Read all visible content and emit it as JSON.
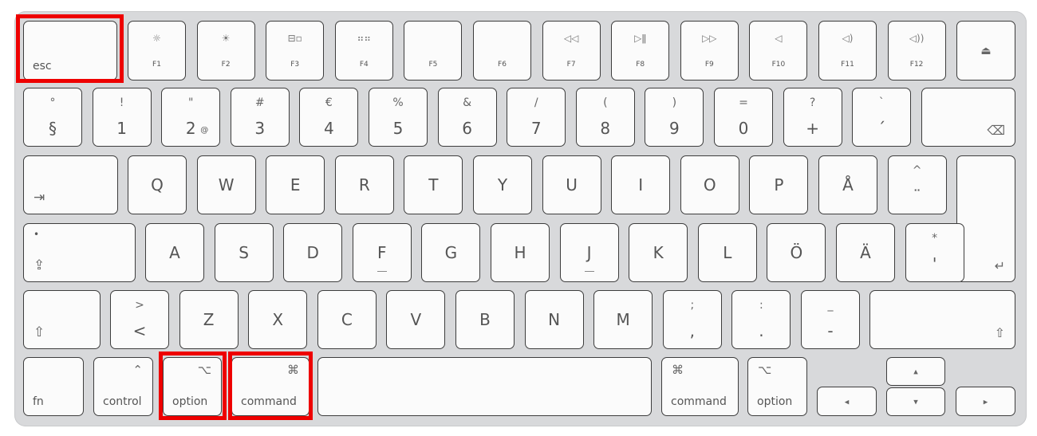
{
  "highlight_color": "#ee0000",
  "highlighted_keys": [
    "esc",
    "option",
    "command"
  ],
  "rows": [
    {
      "keys": [
        {
          "label": "esc"
        },
        {
          "label": "F1",
          "icon": "brightness-down-icon",
          "glyph": "☼"
        },
        {
          "label": "F2",
          "icon": "brightness-up-icon",
          "glyph": "☀"
        },
        {
          "label": "F3",
          "icon": "mission-control-icon",
          "glyph": "⊟▫"
        },
        {
          "label": "F4",
          "icon": "launchpad-icon",
          "glyph": "⠶⠶"
        },
        {
          "label": "F5"
        },
        {
          "label": "F6"
        },
        {
          "label": "F7",
          "icon": "rewind-icon",
          "glyph": "◁◁"
        },
        {
          "label": "F8",
          "icon": "play-pause-icon",
          "glyph": "▷ǁ"
        },
        {
          "label": "F9",
          "icon": "fast-forward-icon",
          "glyph": "▷▷"
        },
        {
          "label": "F10",
          "icon": "mute-icon",
          "glyph": "◁"
        },
        {
          "label": "F11",
          "icon": "volume-down-icon",
          "glyph": "◁)"
        },
        {
          "label": "F12",
          "icon": "volume-up-icon",
          "glyph": "◁))"
        },
        {
          "icon": "eject-icon",
          "glyph": "⏏"
        }
      ]
    },
    {
      "keys": [
        {
          "top": "°",
          "bottom": "§"
        },
        {
          "top": "!",
          "bottom": "1"
        },
        {
          "top": "\"",
          "bottom": "2",
          "sub": "@"
        },
        {
          "top": "#",
          "bottom": "3"
        },
        {
          "top": "€",
          "bottom": "4"
        },
        {
          "top": "%",
          "bottom": "5"
        },
        {
          "top": "&",
          "bottom": "6"
        },
        {
          "top": "/",
          "bottom": "7"
        },
        {
          "top": "(",
          "bottom": "8"
        },
        {
          "top": ")",
          "bottom": "9"
        },
        {
          "top": "=",
          "bottom": "0"
        },
        {
          "top": "?",
          "bottom": "+"
        },
        {
          "top": "`",
          "bottom": "´"
        },
        {
          "icon": "backspace-icon",
          "glyph": "⌫"
        }
      ]
    },
    {
      "keys": [
        {
          "icon": "tab-icon",
          "glyph": "⇥"
        },
        {
          "label": "Q"
        },
        {
          "label": "W"
        },
        {
          "label": "E"
        },
        {
          "label": "R"
        },
        {
          "label": "T"
        },
        {
          "label": "Y"
        },
        {
          "label": "U"
        },
        {
          "label": "I"
        },
        {
          "label": "O"
        },
        {
          "label": "P"
        },
        {
          "label": "Å"
        },
        {
          "top": "^",
          "bottom": "¨"
        },
        {
          "icon": "return-icon",
          "glyph": "↵"
        }
      ]
    },
    {
      "keys": [
        {
          "icon": "caps-lock-icon",
          "glyph": "⇪",
          "dot": "•"
        },
        {
          "label": "A"
        },
        {
          "label": "S"
        },
        {
          "label": "D"
        },
        {
          "label": "F"
        },
        {
          "label": "G"
        },
        {
          "label": "H"
        },
        {
          "label": "J"
        },
        {
          "label": "K"
        },
        {
          "label": "L"
        },
        {
          "label": "Ö"
        },
        {
          "label": "Ä"
        },
        {
          "top": "*",
          "bottom": "'"
        }
      ]
    },
    {
      "keys": [
        {
          "icon": "shift-icon",
          "glyph": "⇧"
        },
        {
          "top": ">",
          "bottom": "<"
        },
        {
          "label": "Z"
        },
        {
          "label": "X"
        },
        {
          "label": "C"
        },
        {
          "label": "V"
        },
        {
          "label": "B"
        },
        {
          "label": "N"
        },
        {
          "label": "M"
        },
        {
          "top": ";",
          "bottom": ","
        },
        {
          "top": ":",
          "bottom": "."
        },
        {
          "top": "_",
          "bottom": "-"
        },
        {
          "icon": "shift-icon",
          "glyph": "⇧"
        }
      ]
    },
    {
      "keys": [
        {
          "label": "fn"
        },
        {
          "label": "control",
          "icon": "control-icon",
          "glyph": "⌃"
        },
        {
          "label": "option",
          "icon": "option-icon",
          "glyph": "⌥"
        },
        {
          "label": "command",
          "icon": "command-icon",
          "glyph": "⌘"
        },
        {},
        {
          "label": "command",
          "icon": "command-icon",
          "glyph": "⌘"
        },
        {
          "label": "option",
          "icon": "option-icon",
          "glyph": "⌥"
        },
        {
          "icon": "arrow-left-icon",
          "glyph": "◂"
        },
        {
          "icon": "arrow-up-icon",
          "glyph": "▴"
        },
        {
          "icon": "arrow-down-icon",
          "glyph": "▾"
        },
        {
          "icon": "arrow-right-icon",
          "glyph": "▸"
        }
      ]
    }
  ]
}
